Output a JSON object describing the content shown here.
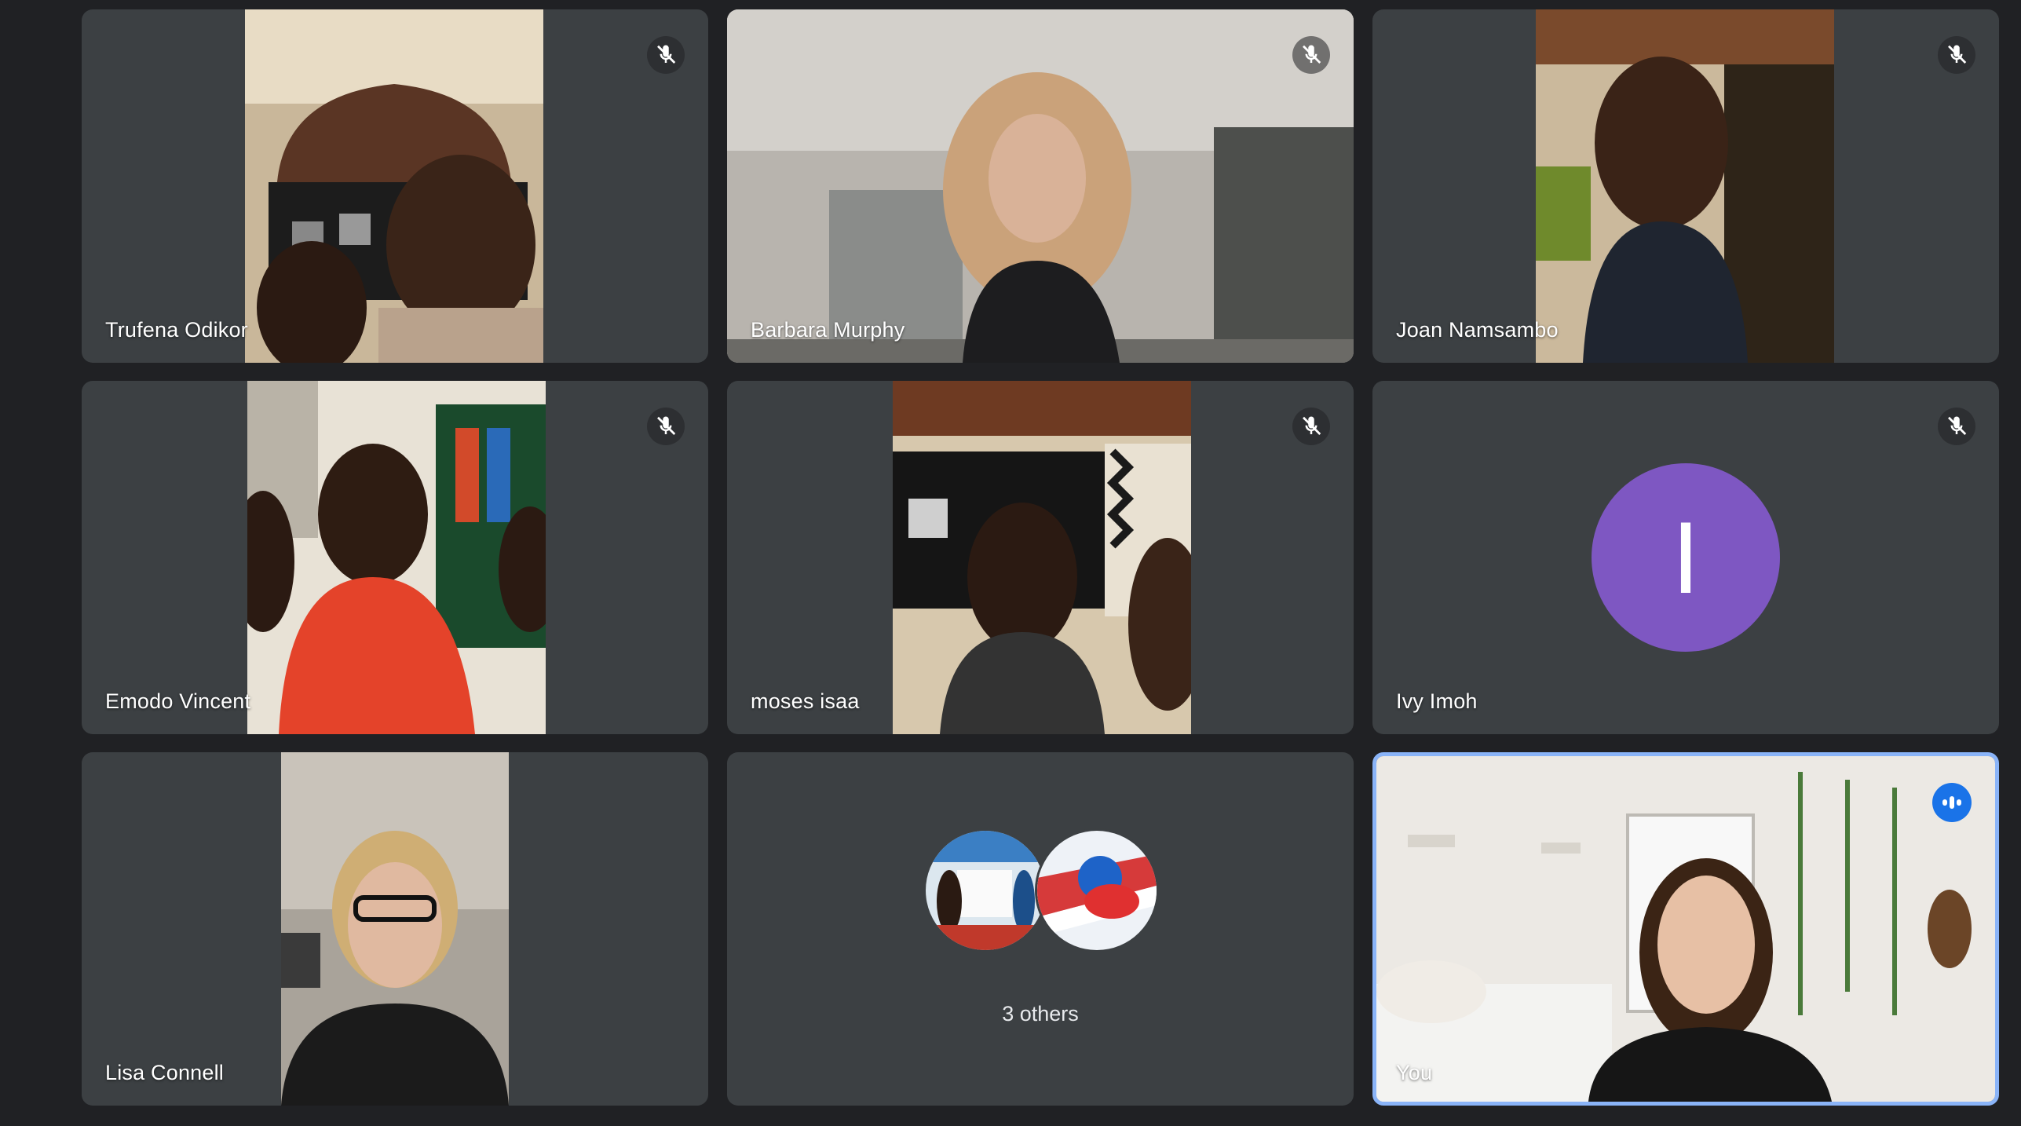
{
  "participants": [
    {
      "name": "Trufena Odikor",
      "muted": true
    },
    {
      "name": "Barbara Murphy",
      "muted": true
    },
    {
      "name": "Joan Namsambo",
      "muted": true
    },
    {
      "name": "Emodo Vincent",
      "muted": true
    },
    {
      "name": "moses isaa",
      "muted": true
    },
    {
      "name": "Ivy Imoh",
      "muted": true,
      "avatar_initial": "I",
      "avatar_color": "#7e57c2"
    },
    {
      "name": "Lisa Connell",
      "muted": false
    }
  ],
  "others": {
    "label": "3 others"
  },
  "self": {
    "name": "You",
    "speaking": true,
    "accent": "#1a73e8"
  },
  "colors": {
    "background": "#202124",
    "tile": "#3c4043",
    "self_border": "#8ab4f8"
  },
  "icons": {
    "mute": "mic-off-icon",
    "speaking": "audio-level-icon"
  }
}
